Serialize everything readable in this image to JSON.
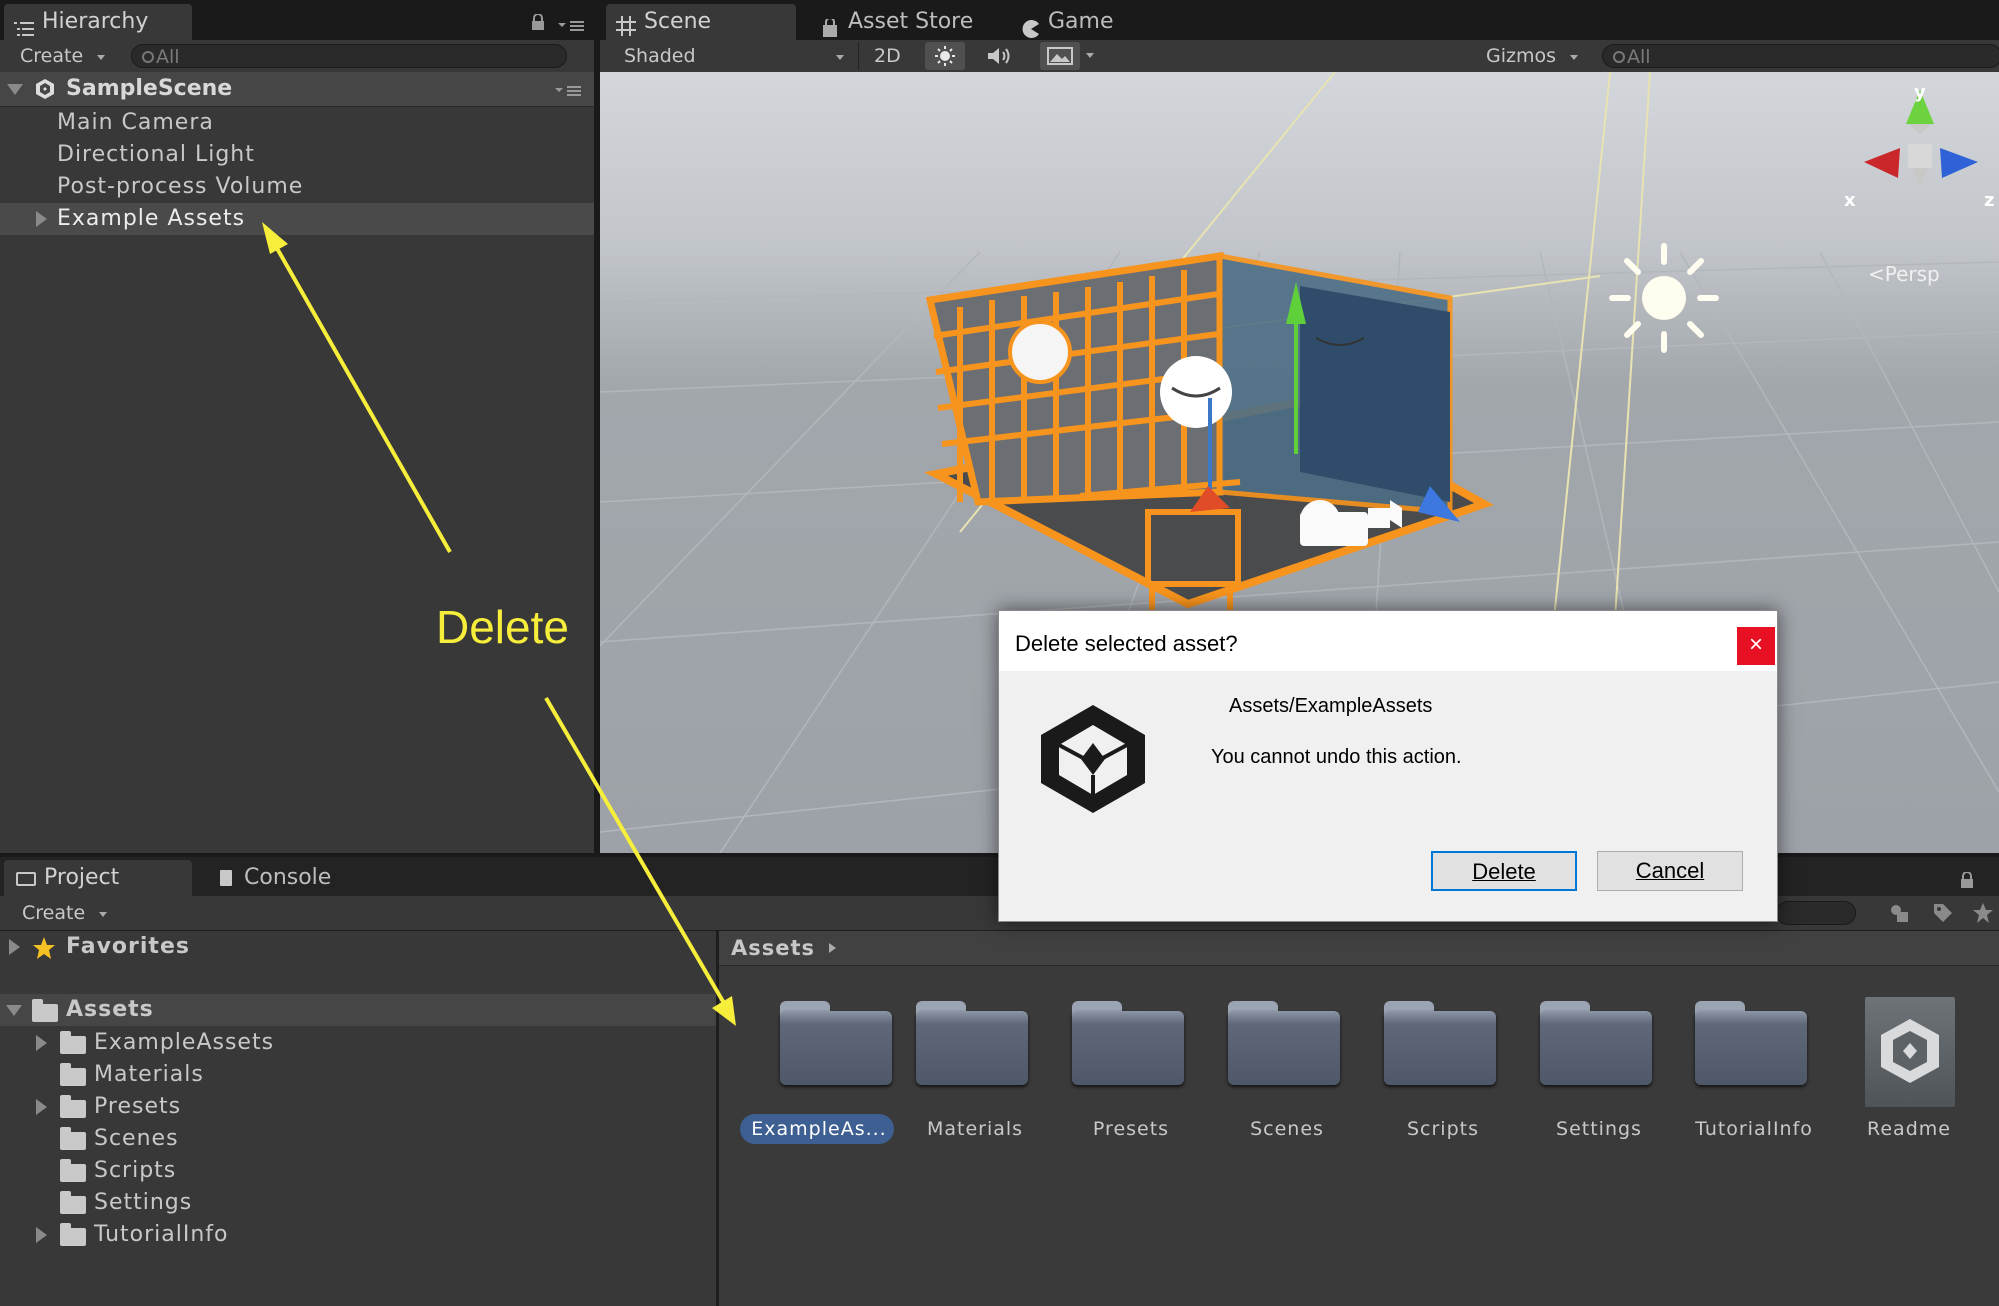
{
  "hierarchy": {
    "tab_label": "Hierarchy",
    "create_label": "Create",
    "search_placeholder": "All",
    "scene_name": "SampleScene",
    "items": [
      "Main Camera",
      "Directional Light",
      "Post-process Volume",
      "Example Assets"
    ]
  },
  "scene_tabs": {
    "scene": "Scene",
    "asset_store": "Asset Store",
    "game": "Game"
  },
  "scene_toolbar": {
    "shading_mode": "Shaded",
    "mode_2d": "2D",
    "gizmos_label": "Gizmos",
    "search_placeholder": "All",
    "persp_label": "Persp",
    "axis_labels": {
      "x": "x",
      "y": "y",
      "z": "z"
    }
  },
  "annotation": {
    "label": "Delete",
    "color": "#f7ee3c"
  },
  "dialog": {
    "title": "Delete selected asset?",
    "path": "Assets/ExampleAssets",
    "message": "You cannot undo this action.",
    "delete_label": "Delete",
    "cancel_label": "Cancel",
    "close_glyph": "×"
  },
  "project": {
    "tab_label": "Project",
    "console_label": "Console",
    "create_label": "Create",
    "favorites_label": "Favorites",
    "assets_label": "Assets",
    "breadcrumb": "Assets",
    "tree": [
      "ExampleAssets",
      "Materials",
      "Presets",
      "Scenes",
      "Scripts",
      "Settings",
      "TutorialInfo"
    ],
    "grid": [
      "ExampleAs...",
      "Materials",
      "Presets",
      "Scenes",
      "Scripts",
      "Settings",
      "TutorialInfo",
      "Readme"
    ]
  },
  "colors": {
    "selection": "#3d5f91",
    "selection_outline": "#f7941d",
    "dialog_close": "#e81123"
  }
}
